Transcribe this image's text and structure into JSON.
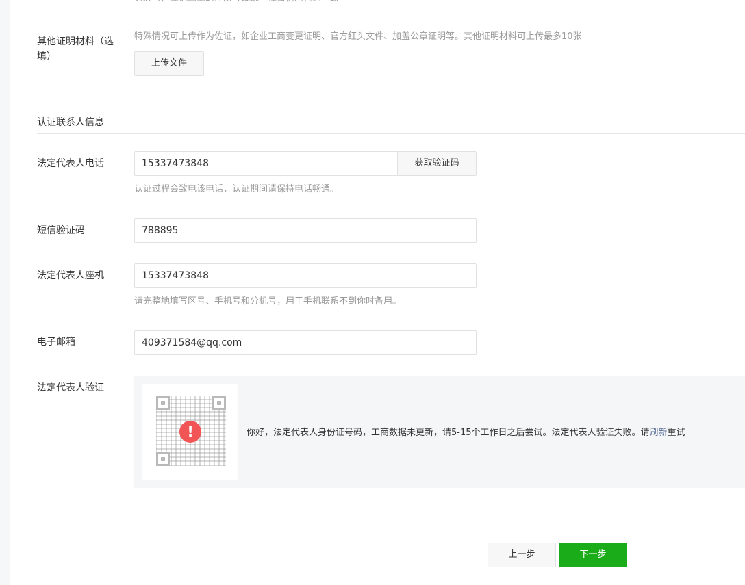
{
  "top_hint_cut": "务必与营业执照上的注册号或统一社会信用代码一致",
  "other_materials": {
    "label_line1": "其他证明材料（选",
    "label_line2": "填）",
    "hint": "特殊情况可上传作为佐证，如企业工商变更证明、官方红头文件、加盖公章证明等。其他证明材料可上传最多10张",
    "upload_button": "上传文件"
  },
  "contact_section": {
    "title": "认证联系人信息"
  },
  "phone": {
    "label": "法定代表人电话",
    "value": "15337473848",
    "get_code_button": "获取验证码",
    "hint": "认证过程会致电该电话，认证期间请保持电话畅通。"
  },
  "sms_code": {
    "label": "短信验证码",
    "value": "788895"
  },
  "landline": {
    "label": "法定代表人座机",
    "value": "15337473848",
    "hint": "请完整地填写区号、手机号和分机号，用于手机联系不到你时备用。"
  },
  "email": {
    "label": "电子邮箱",
    "value": "409371584@qq.com"
  },
  "legal_verify": {
    "label": "法定代表人验证",
    "icon": "warning-icon",
    "warn_symbol": "!",
    "message_prefix": "你好，法定代表人身份证号码，工商数据未更新，请5-15个工作日之后尝试。法定代表人验证失败。请",
    "refresh_link": "刷新",
    "message_suffix": "重试"
  },
  "footer": {
    "prev_button": "上一步",
    "next_button": "下一步"
  },
  "colors": {
    "primary": "#1aad19",
    "link": "#576b95",
    "warning": "#f25555"
  }
}
